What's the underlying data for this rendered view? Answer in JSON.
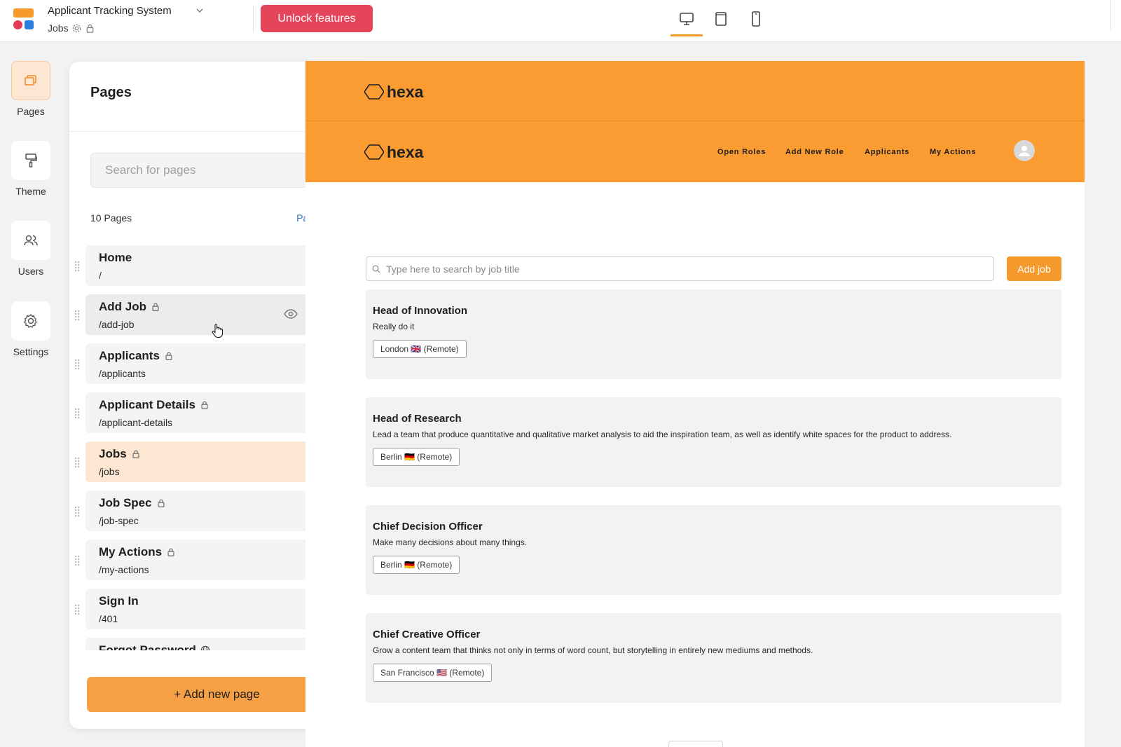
{
  "app": {
    "title": "Applicant Tracking System",
    "current_page": "Jobs",
    "unlock_label": "Unlock features",
    "devices": [
      "desktop-icon",
      "tablet-icon",
      "mobile-icon"
    ],
    "active_device": "desktop",
    "accent_color": "#f79a2e",
    "danger_color": "#e5455a"
  },
  "rail": {
    "items": [
      {
        "label": "Pages",
        "icon": "pages-icon",
        "active": true
      },
      {
        "label": "Theme",
        "icon": "paint-roller-icon",
        "active": false
      },
      {
        "label": "Users",
        "icon": "users-icon",
        "active": false
      },
      {
        "label": "Settings",
        "icon": "gear-icon",
        "active": false
      }
    ]
  },
  "panel": {
    "title": "Pages",
    "search_placeholder": "Search for pages",
    "count_label": "10 Pages",
    "rules_label": "Page rules",
    "add_label": "+ Add new page",
    "pages": [
      {
        "name": "Home",
        "path": "/",
        "icon": "",
        "state": "normal"
      },
      {
        "name": "Add Job",
        "path": "/add-job",
        "icon": "lock-icon",
        "state": "hovered"
      },
      {
        "name": "Applicants",
        "path": "/applicants",
        "icon": "lock-icon",
        "state": "normal"
      },
      {
        "name": "Applicant Details",
        "path": "/applicant-details",
        "icon": "lock-icon",
        "state": "normal"
      },
      {
        "name": "Jobs",
        "path": "/jobs",
        "icon": "lock-icon",
        "state": "selected"
      },
      {
        "name": "Job Spec",
        "path": "/job-spec",
        "icon": "lock-icon",
        "state": "normal"
      },
      {
        "name": "My Actions",
        "path": "/my-actions",
        "icon": "lock-icon",
        "state": "normal"
      },
      {
        "name": "Sign In",
        "path": "/401",
        "icon": "",
        "state": "normal"
      },
      {
        "name": "Forgot Password",
        "path": "",
        "icon": "globe-icon",
        "state": "normal"
      }
    ]
  },
  "preview": {
    "brand": "hexa",
    "nav": [
      "Open Roles",
      "Add New Role",
      "Applicants",
      "My Actions"
    ],
    "search_placeholder": "Type here to search by job title",
    "add_job_label": "Add job",
    "jobs": [
      {
        "title": "Head of Innovation",
        "desc": "Really do it",
        "tag": "London 🇬🇧 (Remote)"
      },
      {
        "title": "Head of Research",
        "desc": "Lead a team that produce quantitative and qualitative market analysis to aid the inspiration team, as well as identify white spaces for the product to address.",
        "tag": "Berlin 🇩🇪 (Remote)"
      },
      {
        "title": "Chief Decision Officer",
        "desc": "Make many decisions about many things.",
        "tag": "Berlin 🇩🇪 (Remote)"
      },
      {
        "title": "Chief Creative Officer",
        "desc": "Grow a content team that thinks not only in terms of word count, but storytelling in entirely new mediums and methods.",
        "tag": "San Francisco 🇺🇸 (Remote)"
      }
    ]
  }
}
